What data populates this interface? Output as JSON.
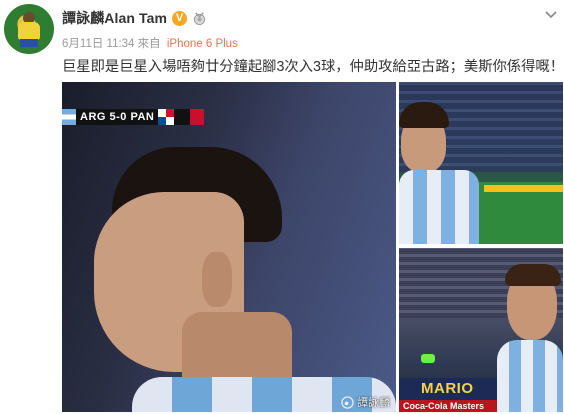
{
  "post": {
    "author_name": "譚詠麟Alan Tam",
    "verified_badge": "V",
    "timestamp": "6月11日 11:34",
    "source_prefix": "來自",
    "source_device": "iPhone 6 Plus",
    "text": "巨星即是巨星入場唔夠廿分鐘起腳3次入3球，仲助攻給亞古路；美斯你係得嘅！"
  },
  "photos": {
    "main": {
      "scoreboard": "ARG 5-0 PAN",
      "watermark": "譚詠麟"
    },
    "thumb2": {
      "board_text": "MARIO",
      "board_text_2": "Coca-Cola   Masters"
    }
  },
  "colors": {
    "source_link": "#eb7350",
    "verified_badge": "#f5a623",
    "meta_text": "#999999"
  },
  "icons": {
    "verified": "verified-badge-icon",
    "medal": "medal-icon",
    "menu": "chevron-down-icon",
    "watermark": "weibo-icon"
  }
}
